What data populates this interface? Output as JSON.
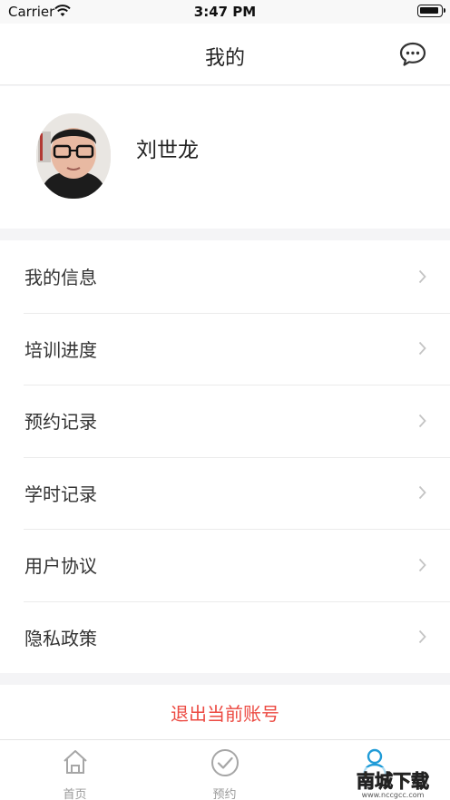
{
  "status_bar": {
    "carrier": "Carrier",
    "time": "3:47 PM"
  },
  "nav": {
    "title": "我的",
    "message_icon": "chat-bubble-icon"
  },
  "profile": {
    "name": "刘世龙"
  },
  "menu": {
    "items": [
      {
        "label": "我的信息"
      },
      {
        "label": "培训进度"
      },
      {
        "label": "预约记录"
      },
      {
        "label": "学时记录"
      },
      {
        "label": "用户协议"
      },
      {
        "label": "隐私政策"
      }
    ]
  },
  "logout": {
    "label": "退出当前账号"
  },
  "tab_bar": {
    "tabs": [
      {
        "label": "首页",
        "icon": "home-icon"
      },
      {
        "label": "预约",
        "icon": "check-circle-icon"
      },
      {
        "label": "",
        "icon": "person-icon",
        "active": true
      }
    ]
  },
  "watermark": {
    "text": "南城下载",
    "sub": "www.nccgcc.com"
  },
  "colors": {
    "accent": "#1f9bd7",
    "danger": "#ec4a42",
    "background": "#f4f4f6"
  }
}
